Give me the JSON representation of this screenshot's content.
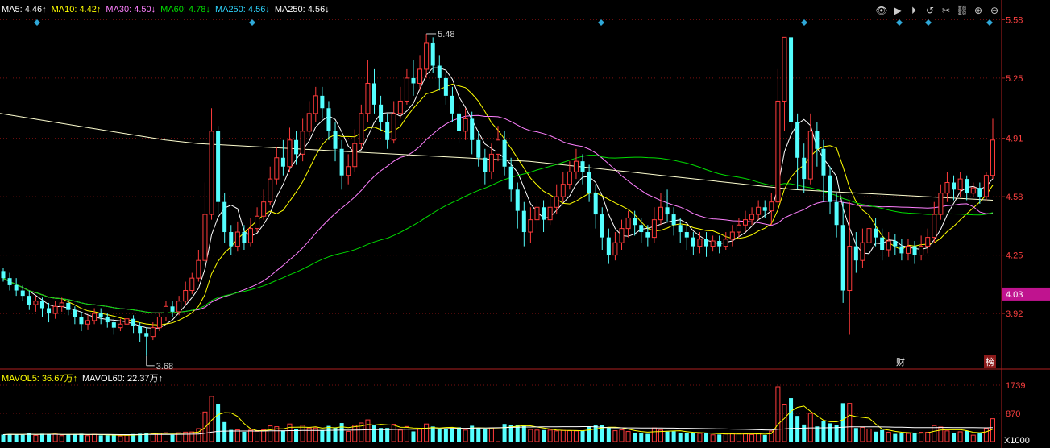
{
  "legend": {
    "items": [
      {
        "label": "MA5: 4.46",
        "arrow": "↑",
        "color": "#ffffff"
      },
      {
        "label": "MA10: 4.42",
        "arrow": "↑",
        "color": "#ffff00"
      },
      {
        "label": "MA30: 4.50",
        "arrow": "↓",
        "color": "#ff80ff"
      },
      {
        "label": "MA60: 4.78",
        "arrow": "↓",
        "color": "#00dd00"
      },
      {
        "label": "MA250: 4.56",
        "arrow": "↓",
        "color": "#2fd6ff"
      },
      {
        "label": "MA250: 4.56",
        "arrow": "↓",
        "color": "#ffffff"
      }
    ]
  },
  "vol_legend": {
    "items": [
      {
        "label": "MAVOL5: 36.67万",
        "arrow": "↑",
        "color": "#ffff00"
      },
      {
        "label": "MAVOL60: 22.37万",
        "arrow": "↑",
        "color": "#ffffff"
      }
    ]
  },
  "toolbar": {
    "icons": [
      "eye-icon",
      "play-icon",
      "play-circle-icon",
      "undo-icon",
      "scissors-icon",
      "link-icon",
      "zoom-in-icon",
      "zoom-out-icon"
    ],
    "glyphs": [
      "👁",
      "▶",
      "⏵",
      "↺",
      "✂",
      "⛓",
      "⊕",
      "⊖"
    ]
  },
  "badges": {
    "finance": "财",
    "rank": "榜"
  },
  "colors": {
    "up": "#ff3b3b",
    "down": "#54ffff",
    "grid": "#7a1010",
    "axis": "#b02020",
    "price_label": "#ff4040",
    "current": "#c0138f",
    "low_high_label": "#cccccc"
  },
  "chart_data": [
    {
      "type": "candlestick",
      "title": "",
      "y_ticks": [
        5.58,
        5.25,
        4.91,
        4.58,
        4.25,
        3.92
      ],
      "ylim": [
        3.62,
        5.6
      ],
      "current_price": "4.03",
      "high_label": "5.48",
      "low_label": "3.68",
      "grid": true,
      "candles_note": "values read approximately",
      "candles": [
        [
          4.16,
          4.12,
          4.18,
          4.1
        ],
        [
          4.12,
          4.08,
          4.15,
          4.05
        ],
        [
          4.08,
          4.05,
          4.12,
          4.02
        ],
        [
          4.05,
          4.02,
          4.08,
          3.99
        ],
        [
          4.02,
          3.97,
          4.05,
          3.94
        ],
        [
          3.97,
          3.99,
          4.02,
          3.93
        ],
        [
          3.99,
          3.95,
          4.01,
          3.9
        ],
        [
          3.95,
          3.92,
          3.98,
          3.87
        ],
        [
          3.92,
          3.96,
          3.99,
          3.89
        ],
        [
          3.96,
          3.98,
          4.01,
          3.93
        ],
        [
          3.98,
          3.94,
          4.0,
          3.91
        ],
        [
          3.94,
          3.9,
          3.96,
          3.86
        ],
        [
          3.9,
          3.86,
          3.93,
          3.82
        ],
        [
          3.86,
          3.88,
          3.91,
          3.83
        ],
        [
          3.88,
          3.92,
          3.95,
          3.86
        ],
        [
          3.92,
          3.9,
          3.95,
          3.86
        ],
        [
          3.9,
          3.87,
          3.92,
          3.84
        ],
        [
          3.87,
          3.84,
          3.89,
          3.8
        ],
        [
          3.84,
          3.86,
          3.89,
          3.82
        ],
        [
          3.86,
          3.89,
          3.92,
          3.84
        ],
        [
          3.89,
          3.85,
          3.91,
          3.81
        ],
        [
          3.85,
          3.81,
          3.87,
          3.76
        ],
        [
          3.81,
          3.79,
          3.84,
          3.68
        ],
        [
          3.79,
          3.84,
          3.87,
          3.77
        ],
        [
          3.84,
          3.9,
          3.92,
          3.82
        ],
        [
          3.9,
          3.96,
          3.99,
          3.88
        ],
        [
          3.96,
          3.93,
          3.99,
          3.9
        ],
        [
          3.93,
          3.99,
          4.02,
          3.91
        ],
        [
          3.99,
          4.05,
          4.1,
          3.97
        ],
        [
          4.05,
          4.12,
          4.15,
          4.03
        ],
        [
          4.12,
          4.22,
          4.28,
          4.1
        ],
        [
          4.22,
          4.48,
          4.66,
          4.2
        ],
        [
          4.48,
          4.95,
          5.08,
          4.45
        ],
        [
          4.95,
          4.55,
          4.98,
          4.48
        ],
        [
          4.55,
          4.38,
          4.6,
          4.32
        ],
        [
          4.38,
          4.3,
          4.42,
          4.25
        ],
        [
          4.3,
          4.38,
          4.44,
          4.27
        ],
        [
          4.38,
          4.32,
          4.42,
          4.28
        ],
        [
          4.32,
          4.4,
          4.46,
          4.3
        ],
        [
          4.4,
          4.47,
          4.52,
          4.38
        ],
        [
          4.47,
          4.55,
          4.62,
          4.45
        ],
        [
          4.55,
          4.68,
          4.75,
          4.53
        ],
        [
          4.68,
          4.8,
          4.86,
          4.65
        ],
        [
          4.8,
          4.75,
          4.9,
          4.7
        ],
        [
          4.75,
          4.9,
          4.97,
          4.72
        ],
        [
          4.9,
          4.82,
          4.95,
          4.76
        ],
        [
          4.82,
          4.95,
          5.02,
          4.78
        ],
        [
          4.95,
          5.05,
          5.12,
          4.92
        ],
        [
          5.05,
          5.15,
          5.2,
          5.0
        ],
        [
          5.15,
          5.08,
          5.2,
          5.02
        ],
        [
          5.08,
          4.95,
          5.12,
          4.9
        ],
        [
          4.95,
          4.85,
          5.0,
          4.78
        ],
        [
          4.85,
          4.7,
          4.9,
          4.62
        ],
        [
          4.7,
          4.75,
          4.82,
          4.65
        ],
        [
          4.75,
          4.88,
          4.96,
          4.72
        ],
        [
          4.88,
          5.05,
          5.1,
          4.85
        ],
        [
          5.05,
          5.22,
          5.35,
          5.0
        ],
        [
          5.22,
          5.1,
          5.3,
          5.05
        ],
        [
          5.1,
          5.0,
          5.15,
          4.95
        ],
        [
          5.0,
          4.9,
          5.05,
          4.85
        ],
        [
          4.9,
          5.05,
          5.12,
          4.88
        ],
        [
          5.05,
          5.12,
          5.2,
          5.02
        ],
        [
          5.12,
          5.25,
          5.3,
          5.1
        ],
        [
          5.25,
          5.22,
          5.35,
          5.15
        ],
        [
          5.22,
          5.3,
          5.38,
          5.18
        ],
        [
          5.3,
          5.45,
          5.5,
          5.25
        ],
        [
          5.45,
          5.32,
          5.48,
          5.28
        ],
        [
          5.32,
          5.25,
          5.38,
          5.18
        ],
        [
          5.25,
          5.15,
          5.28,
          5.1
        ],
        [
          5.15,
          5.05,
          5.2,
          5.0
        ],
        [
          5.05,
          4.95,
          5.1,
          4.88
        ],
        [
          4.95,
          5.02,
          5.08,
          4.9
        ],
        [
          5.02,
          4.9,
          5.06,
          4.82
        ],
        [
          4.9,
          4.8,
          4.95,
          4.75
        ],
        [
          4.8,
          4.72,
          4.85,
          4.65
        ],
        [
          4.72,
          4.82,
          4.88,
          4.68
        ],
        [
          4.82,
          4.9,
          4.98,
          4.78
        ],
        [
          4.9,
          4.75,
          4.95,
          4.7
        ],
        [
          4.75,
          4.62,
          4.8,
          4.55
        ],
        [
          4.62,
          4.5,
          4.66,
          4.4
        ],
        [
          4.5,
          4.38,
          4.55,
          4.3
        ],
        [
          4.38,
          4.45,
          4.52,
          4.32
        ],
        [
          4.45,
          4.52,
          4.58,
          4.4
        ],
        [
          4.52,
          4.45,
          4.56,
          4.38
        ],
        [
          4.45,
          4.52,
          4.6,
          4.42
        ],
        [
          4.52,
          4.58,
          4.65,
          4.48
        ],
        [
          4.58,
          4.65,
          4.72,
          4.55
        ],
        [
          4.65,
          4.72,
          4.78,
          4.62
        ],
        [
          4.72,
          4.78,
          4.85,
          4.68
        ],
        [
          4.78,
          4.72,
          4.82,
          4.65
        ],
        [
          4.72,
          4.6,
          4.76,
          4.55
        ],
        [
          4.6,
          4.48,
          4.65,
          4.4
        ],
        [
          4.48,
          4.35,
          4.52,
          4.28
        ],
        [
          4.35,
          4.25,
          4.4,
          4.2
        ],
        [
          4.25,
          4.32,
          4.38,
          4.22
        ],
        [
          4.32,
          4.4,
          4.45,
          4.28
        ],
        [
          4.4,
          4.46,
          4.5,
          4.35
        ],
        [
          4.46,
          4.42,
          4.5,
          4.36
        ],
        [
          4.42,
          4.38,
          4.46,
          4.32
        ],
        [
          4.38,
          4.35,
          4.42,
          4.3
        ],
        [
          4.35,
          4.45,
          4.52,
          4.32
        ],
        [
          4.45,
          4.52,
          4.6,
          4.42
        ],
        [
          4.52,
          4.48,
          4.62,
          4.44
        ],
        [
          4.48,
          4.42,
          4.52,
          4.36
        ],
        [
          4.42,
          4.38,
          4.46,
          4.32
        ],
        [
          4.38,
          4.35,
          4.42,
          4.28
        ],
        [
          4.35,
          4.3,
          4.38,
          4.25
        ],
        [
          4.3,
          4.34,
          4.38,
          4.26
        ],
        [
          4.34,
          4.3,
          4.38,
          4.24
        ],
        [
          4.3,
          4.33,
          4.36,
          4.27
        ],
        [
          4.33,
          4.3,
          4.36,
          4.26
        ],
        [
          4.3,
          4.34,
          4.38,
          4.28
        ],
        [
          4.34,
          4.38,
          4.42,
          4.3
        ],
        [
          4.38,
          4.42,
          4.46,
          4.35
        ],
        [
          4.42,
          4.45,
          4.5,
          4.38
        ],
        [
          4.45,
          4.48,
          4.52,
          4.42
        ],
        [
          4.48,
          4.52,
          4.56,
          4.45
        ],
        [
          4.52,
          4.5,
          4.56,
          4.46
        ],
        [
          4.5,
          4.55,
          4.6,
          4.42
        ],
        [
          4.55,
          5.12,
          5.3,
          4.52
        ],
        [
          5.12,
          5.48,
          5.48,
          4.95
        ],
        [
          5.48,
          5.0,
          5.48,
          4.92
        ],
        [
          5.0,
          4.8,
          5.05,
          4.62
        ],
        [
          4.8,
          4.68,
          4.88,
          4.6
        ],
        [
          4.68,
          4.95,
          5.05,
          4.65
        ],
        [
          4.95,
          4.85,
          5.0,
          4.75
        ],
        [
          4.85,
          4.7,
          4.9,
          4.55
        ],
        [
          4.7,
          4.55,
          4.75,
          4.48
        ],
        [
          4.55,
          4.42,
          4.6,
          4.35
        ],
        [
          4.42,
          4.05,
          4.55,
          3.98
        ],
        [
          4.05,
          4.3,
          4.55,
          3.8
        ],
        [
          4.3,
          4.22,
          4.38,
          4.15
        ],
        [
          4.22,
          4.32,
          4.4,
          4.18
        ],
        [
          4.32,
          4.4,
          4.48,
          4.28
        ],
        [
          4.4,
          4.35,
          4.46,
          4.3
        ],
        [
          4.35,
          4.28,
          4.4,
          4.22
        ],
        [
          4.28,
          4.33,
          4.38,
          4.24
        ],
        [
          4.33,
          4.3,
          4.37,
          4.25
        ],
        [
          4.3,
          4.26,
          4.34,
          4.22
        ],
        [
          4.26,
          4.3,
          4.34,
          4.22
        ],
        [
          4.3,
          4.25,
          4.33,
          4.2
        ],
        [
          4.25,
          4.3,
          4.36,
          4.22
        ],
        [
          4.3,
          4.35,
          4.4,
          4.26
        ],
        [
          4.35,
          4.48,
          4.55,
          4.32
        ],
        [
          4.48,
          4.6,
          4.65,
          4.45
        ],
        [
          4.6,
          4.66,
          4.72,
          4.55
        ],
        [
          4.66,
          4.62,
          4.7,
          4.56
        ],
        [
          4.62,
          4.68,
          4.72,
          4.58
        ],
        [
          4.68,
          4.6,
          4.7,
          4.56
        ],
        [
          4.6,
          4.63,
          4.66,
          4.58
        ],
        [
          4.63,
          4.58,
          4.66,
          4.54
        ],
        [
          4.58,
          4.7,
          4.72,
          4.56
        ],
        [
          4.7,
          4.9,
          5.02,
          4.68
        ]
      ],
      "ma_series": [
        {
          "name": "MA5",
          "color": "#ffffff",
          "period": 5
        },
        {
          "name": "MA10",
          "color": "#ffff00",
          "period": 10
        },
        {
          "name": "MA30",
          "color": "#ff80ff",
          "period": 30
        },
        {
          "name": "MA60",
          "color": "#00dd00",
          "period": 60
        },
        {
          "name": "MA250",
          "color": "#ffffd0",
          "values_note": "long-term line read from chart",
          "points": [
            5.05,
            5.02,
            4.99,
            4.96,
            4.93,
            4.9,
            4.88,
            4.87,
            4.86,
            4.85,
            4.84,
            4.83,
            4.82,
            4.81,
            4.8,
            4.79,
            4.78,
            4.76,
            4.74,
            4.72,
            4.7,
            4.68,
            4.66,
            4.64,
            4.62,
            4.61,
            4.6,
            4.59,
            4.58,
            4.57,
            4.56
          ]
        }
      ]
    },
    {
      "type": "bar",
      "title": "",
      "y_ticks": [
        "1739",
        "870"
      ],
      "unit_label": "X1000",
      "volume_note": "relative heights read approximately",
      "series": [
        {
          "name": "MAVOL5",
          "color": "#ffff00"
        },
        {
          "name": "MAVOL60",
          "color": "#ffffff"
        }
      ]
    }
  ]
}
